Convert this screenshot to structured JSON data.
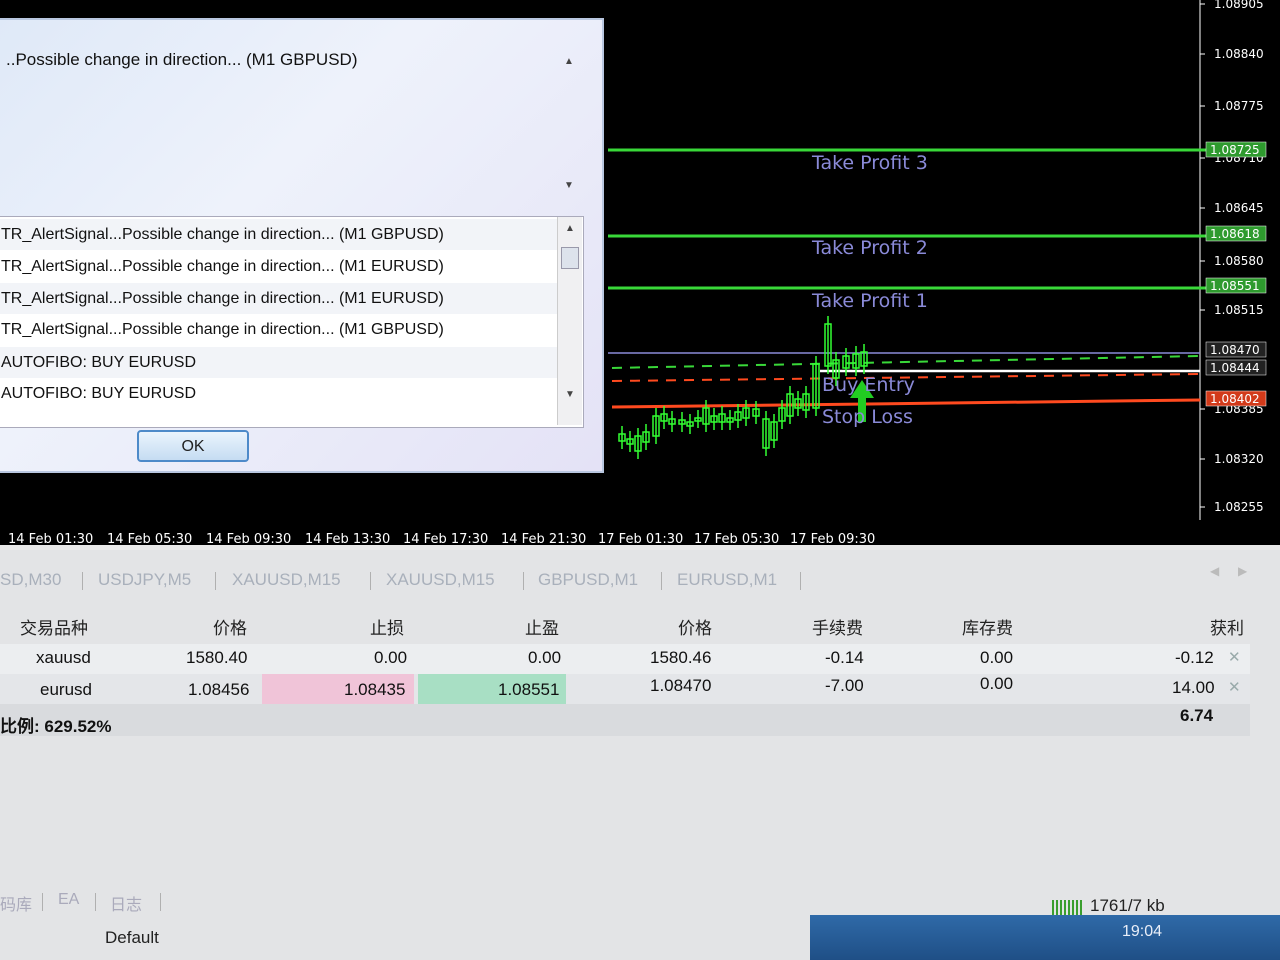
{
  "chart": {
    "price_scale": [
      "1.08905",
      "1.08840",
      "1.08775",
      "1.08710",
      "1.08645",
      "1.08580",
      "1.08515",
      "1.08385",
      "1.08320",
      "1.08255"
    ],
    "price_tags": [
      {
        "value": "1.08725",
        "color": "#2e9a2e"
      },
      {
        "value": "1.08618",
        "color": "#2e9a2e"
      },
      {
        "value": "1.08551",
        "color": "#2e9a2e"
      },
      {
        "value": "1.08470",
        "color": "#111111"
      },
      {
        "value": "1.08444",
        "color": "#111111"
      },
      {
        "value": "1.08402",
        "color": "#d23a1a"
      }
    ],
    "levels": {
      "tp3": "Take Profit 3",
      "tp2": "Take Profit 2",
      "tp1": "Take Profit 1",
      "entry": "Buy Entry",
      "sl": "Stop Loss"
    },
    "colors": {
      "tp": "#39d839",
      "entry": "#ffffff",
      "sl": "#ff4a1f",
      "label": "#8a8ad8",
      "candle": "#33ff33"
    },
    "time_labels": [
      "14 Feb 01:30",
      "14 Feb 05:30",
      "14 Feb 09:30",
      "14 Feb 13:30",
      "14 Feb 17:30",
      "14 Feb 21:30",
      "17 Feb 01:30",
      "17 Feb 05:30",
      "17 Feb 09:30"
    ]
  },
  "alert": {
    "message": "..Possible change in direction... (M1 GBPUSD)",
    "list": [
      "TR_AlertSignal...Possible change in direction... (M1 GBPUSD)",
      "TR_AlertSignal...Possible change in direction... (M1 EURUSD)",
      "TR_AlertSignal...Possible change in direction... (M1 EURUSD)",
      "TR_AlertSignal...Possible change in direction... (M1 GBPUSD)",
      "AUTOFIBO:  BUY EURUSD",
      "AUTOFIBO:  BUY EURUSD"
    ],
    "ok_label": "OK"
  },
  "tabs": [
    "SD,M30",
    "USDJPY,M5",
    "XAUUSD,M15",
    "XAUUSD,M15",
    "GBPUSD,M1",
    "EURUSD,M1"
  ],
  "table": {
    "headers": {
      "symbol": "交易品种",
      "price": "价格",
      "sl": "止损",
      "tp": "止盈",
      "price2": "价格",
      "commission": "手续费",
      "swap": "库存费",
      "profit": "获利"
    },
    "rows": [
      {
        "symbol": "xauusd",
        "price": "1580.40",
        "sl": "0.00",
        "tp": "0.00",
        "price2": "1580.46",
        "commission": "-0.14",
        "swap": "0.00",
        "profit": "-0.12"
      },
      {
        "symbol": "eurusd",
        "price": "1.08456",
        "sl": "1.08435",
        "tp": "1.08551",
        "price2": "1.08470",
        "commission": "-7.00",
        "swap": "0.00",
        "profit": "14.00"
      }
    ],
    "total_profit": "6.74",
    "margin_level": "比例: 629.52%"
  },
  "bottom_tabs": [
    "码库",
    "EA",
    "日志"
  ],
  "status": {
    "profile": "Default",
    "traffic": "1761/7 kb"
  },
  "taskbar": {
    "time": "19:04"
  }
}
